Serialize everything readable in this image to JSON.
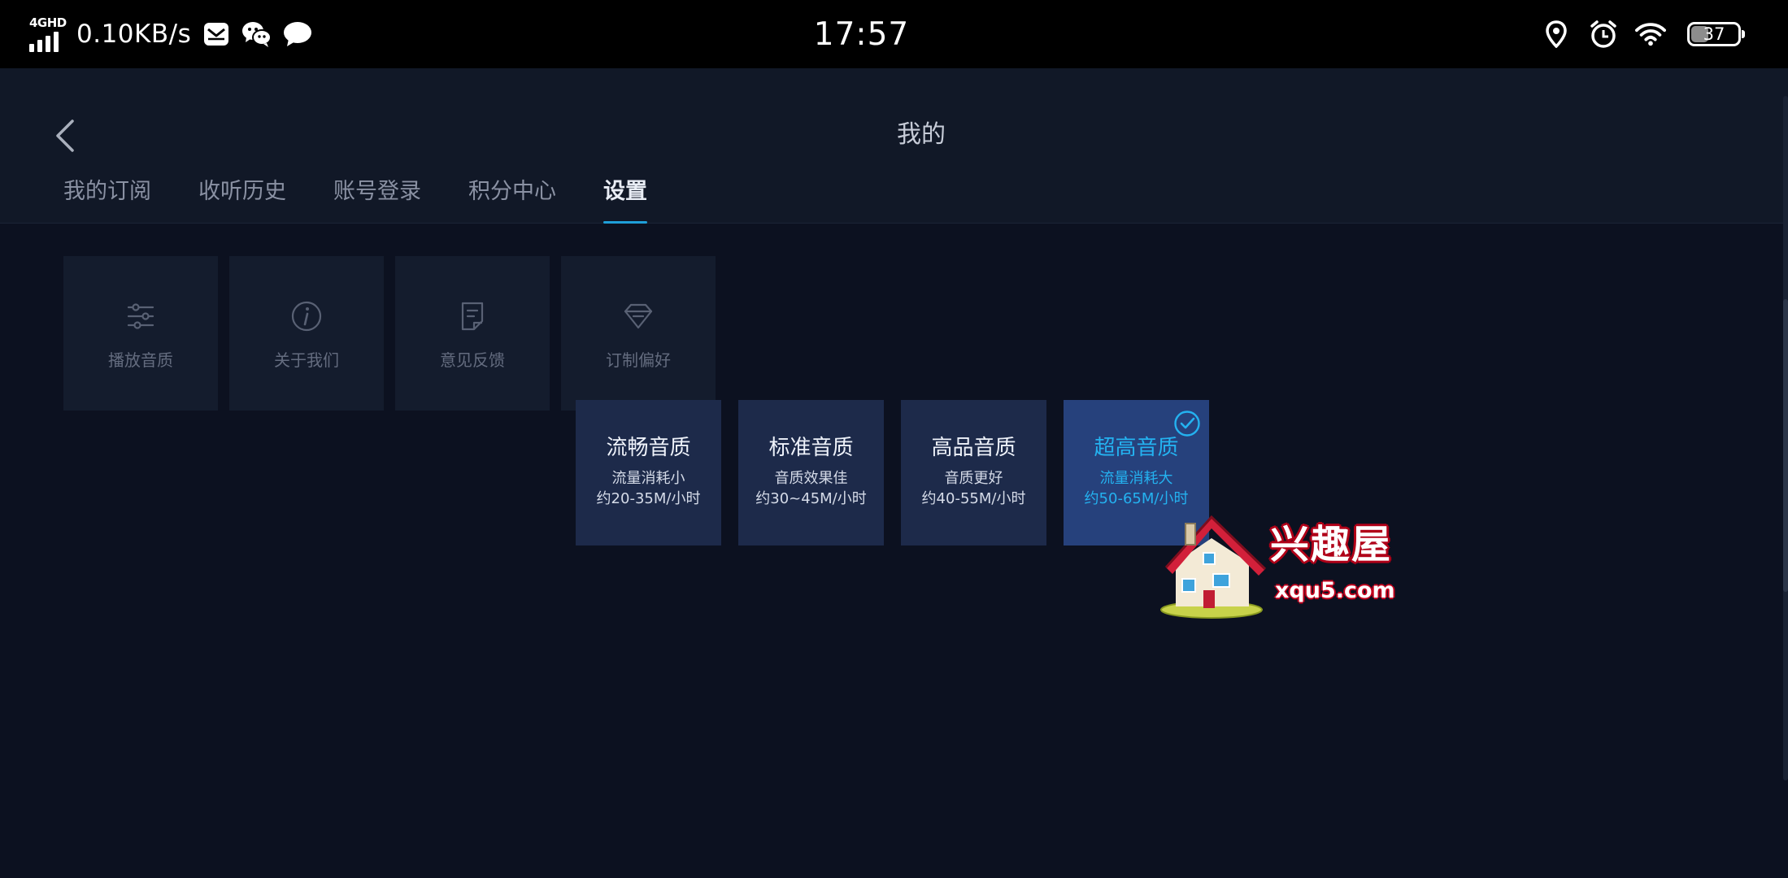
{
  "status_bar": {
    "network_type": "4GHD",
    "net_speed": "0.10KB/s",
    "time": "17:57",
    "battery_level": "37",
    "battery_fraction": 0.37,
    "icons": [
      "signal-icon",
      "mail-icon",
      "wechat-icon",
      "message-icon",
      "location-icon",
      "alarm-icon",
      "wifi-icon",
      "battery-icon"
    ]
  },
  "header": {
    "title": "我的",
    "back_icon": "chevron-left-icon",
    "tabs": [
      {
        "label": "我的订阅",
        "active": false
      },
      {
        "label": "收听历史",
        "active": false
      },
      {
        "label": "账号登录",
        "active": false
      },
      {
        "label": "积分中心",
        "active": false
      },
      {
        "label": "设置",
        "active": true
      }
    ]
  },
  "settings": [
    {
      "label": "播放音质",
      "icon": "sliders-icon"
    },
    {
      "label": "关于我们",
      "icon": "info-icon"
    },
    {
      "label": "意见反馈",
      "icon": "feedback-icon"
    },
    {
      "label": "订制偏好",
      "icon": "diamond-icon"
    }
  ],
  "quality_options": [
    {
      "title": "流畅音质",
      "desc1": "流量消耗小",
      "desc2": "约20-35M/小时",
      "selected": false
    },
    {
      "title": "标准音质",
      "desc1": "音质效果佳",
      "desc2": "约30~45M/小时",
      "selected": false
    },
    {
      "title": "高品音质",
      "desc1": "音质更好",
      "desc2": "约40-55M/小时",
      "selected": false
    },
    {
      "title": "超高音质",
      "desc1": "流量消耗大",
      "desc2": "约50-65M/小时",
      "selected": true
    }
  ],
  "watermark": {
    "text": "兴趣屋",
    "url": "xqu5.com"
  },
  "colors": {
    "background": "#0c1120",
    "header": "#111827",
    "card": "#141c2d",
    "quality_card": "#1d2a4a",
    "quality_selected": "#26417c",
    "accent": "#24b2f0"
  }
}
